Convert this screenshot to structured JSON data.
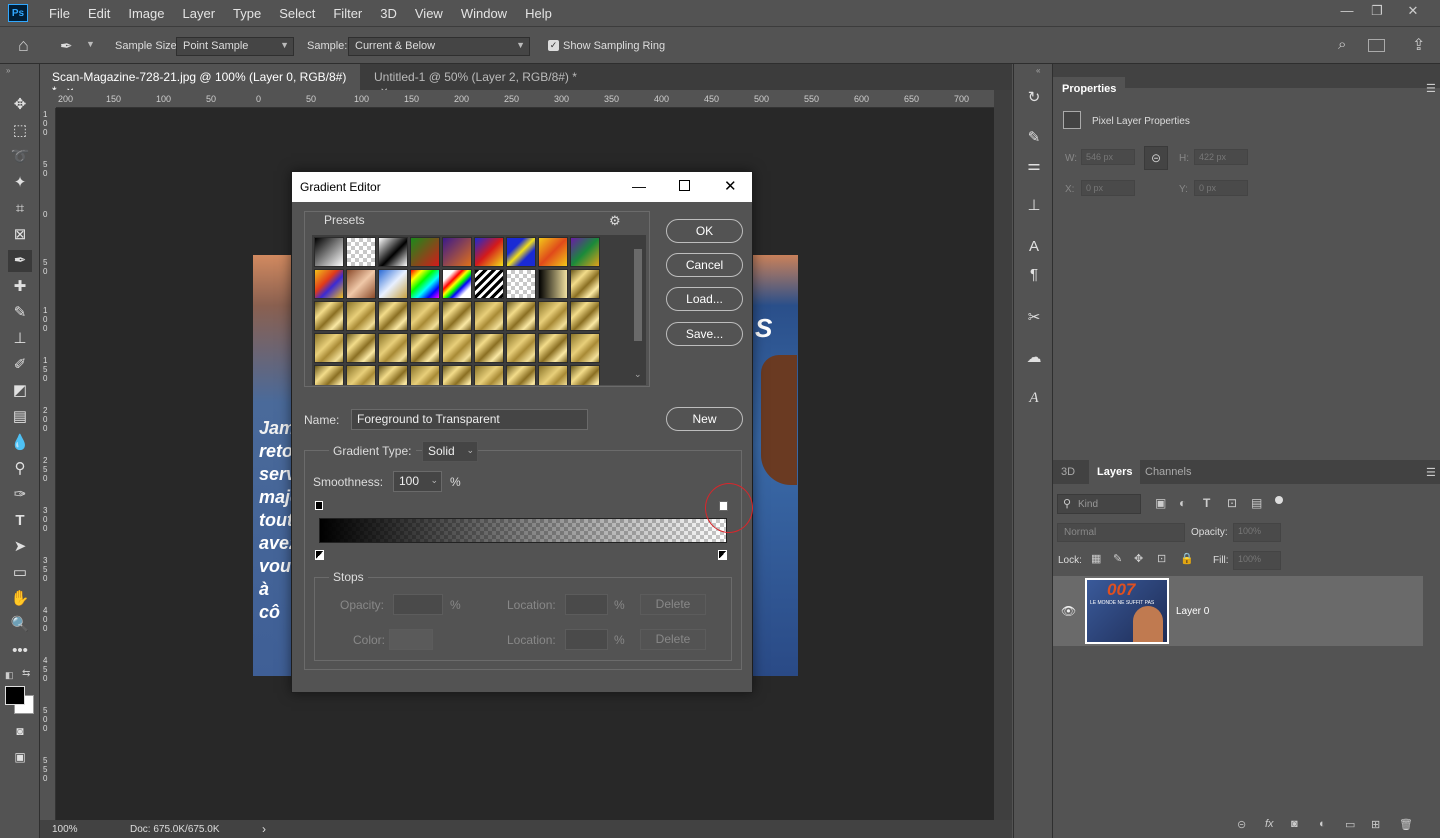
{
  "menubar": {
    "logo": "Ps",
    "items": [
      "File",
      "Edit",
      "Image",
      "Layer",
      "Type",
      "Select",
      "Filter",
      "3D",
      "View",
      "Window",
      "Help"
    ],
    "minimize_label": "—",
    "restore_label": "❐",
    "close_label": "✕"
  },
  "options": {
    "sample_size_label": "Sample Size:",
    "sample_size_value": "Point Sample",
    "sample_label": "Sample:",
    "sample_value": "Current & Below",
    "sampling_ring_label": "Show Sampling Ring"
  },
  "tabs": [
    {
      "label": "Scan-Magazine-728-21.jpg @ 100% (Layer 0, RGB/8#) *",
      "close": "✕"
    },
    {
      "label": "Untitled-1 @ 50% (Layer 2, RGB/8#) *",
      "close": "✕"
    }
  ],
  "ruler_top": [
    "200",
    "150",
    "100",
    "50",
    "0",
    "50",
    "100",
    "150",
    "200",
    "250",
    "300",
    "350",
    "400",
    "450",
    "500",
    "550",
    "600",
    "650",
    "700"
  ],
  "ruler_left": [
    "1\n0\n0",
    "5\n0",
    "0",
    "5\n0",
    "1\n0\n0",
    "1\n5\n0",
    "2\n0\n0",
    "2\n5\n0",
    "3\n0\n0",
    "3\n5\n0",
    "4\n0\n0",
    "4\n5\n0",
    "5\n0\n0",
    "5\n5\n0"
  ],
  "status": {
    "zoom": "100%",
    "doc": "Doc: 675.0K/675.0K",
    "arrow": "›"
  },
  "magazine_text": [
    "Jam",
    "retor",
    "serv",
    "maje",
    "tout",
    "avez",
    "vous",
    "à cô"
  ],
  "magazine_right": "S",
  "properties": {
    "tab": "Properties",
    "section": "Pixel Layer Properties",
    "w_label": "W:",
    "w_value": "546 px",
    "h_label": "H:",
    "h_value": "422 px",
    "x_label": "X:",
    "x_value": "0 px",
    "y_label": "Y:",
    "y_value": "0 px"
  },
  "layers_panel": {
    "tabs": [
      "3D",
      "Layers",
      "Channels"
    ],
    "kind_placeholder": "Kind",
    "blend_mode": "Normal",
    "opacity_label": "Opacity:",
    "opacity_value": "100%",
    "lock_label": "Lock:",
    "fill_label": "Fill:",
    "fill_value": "100%",
    "layer_name": "Layer 0",
    "thumb_text": "007",
    "thumb_subtext": "LE MONDE NE SUFFIT PAS"
  },
  "dialog": {
    "title": "Gradient Editor",
    "presets_label": "Presets",
    "ok": "OK",
    "cancel": "Cancel",
    "load": "Load...",
    "save": "Save...",
    "new": "New",
    "name_label": "Name:",
    "name_value": "Foreground to Transparent",
    "gradient_type_label": "Gradient Type:",
    "gradient_type_value": "Solid",
    "smoothness_label": "Smoothness:",
    "smoothness_value": "100",
    "percent": "%",
    "stops_label": "Stops",
    "opacity_label": "Opacity:",
    "location_label": "Location:",
    "color_label": "Color:",
    "delete": "Delete"
  },
  "colors": {
    "annotation_circle": "#d9262b",
    "accent": "#31a8ff"
  }
}
